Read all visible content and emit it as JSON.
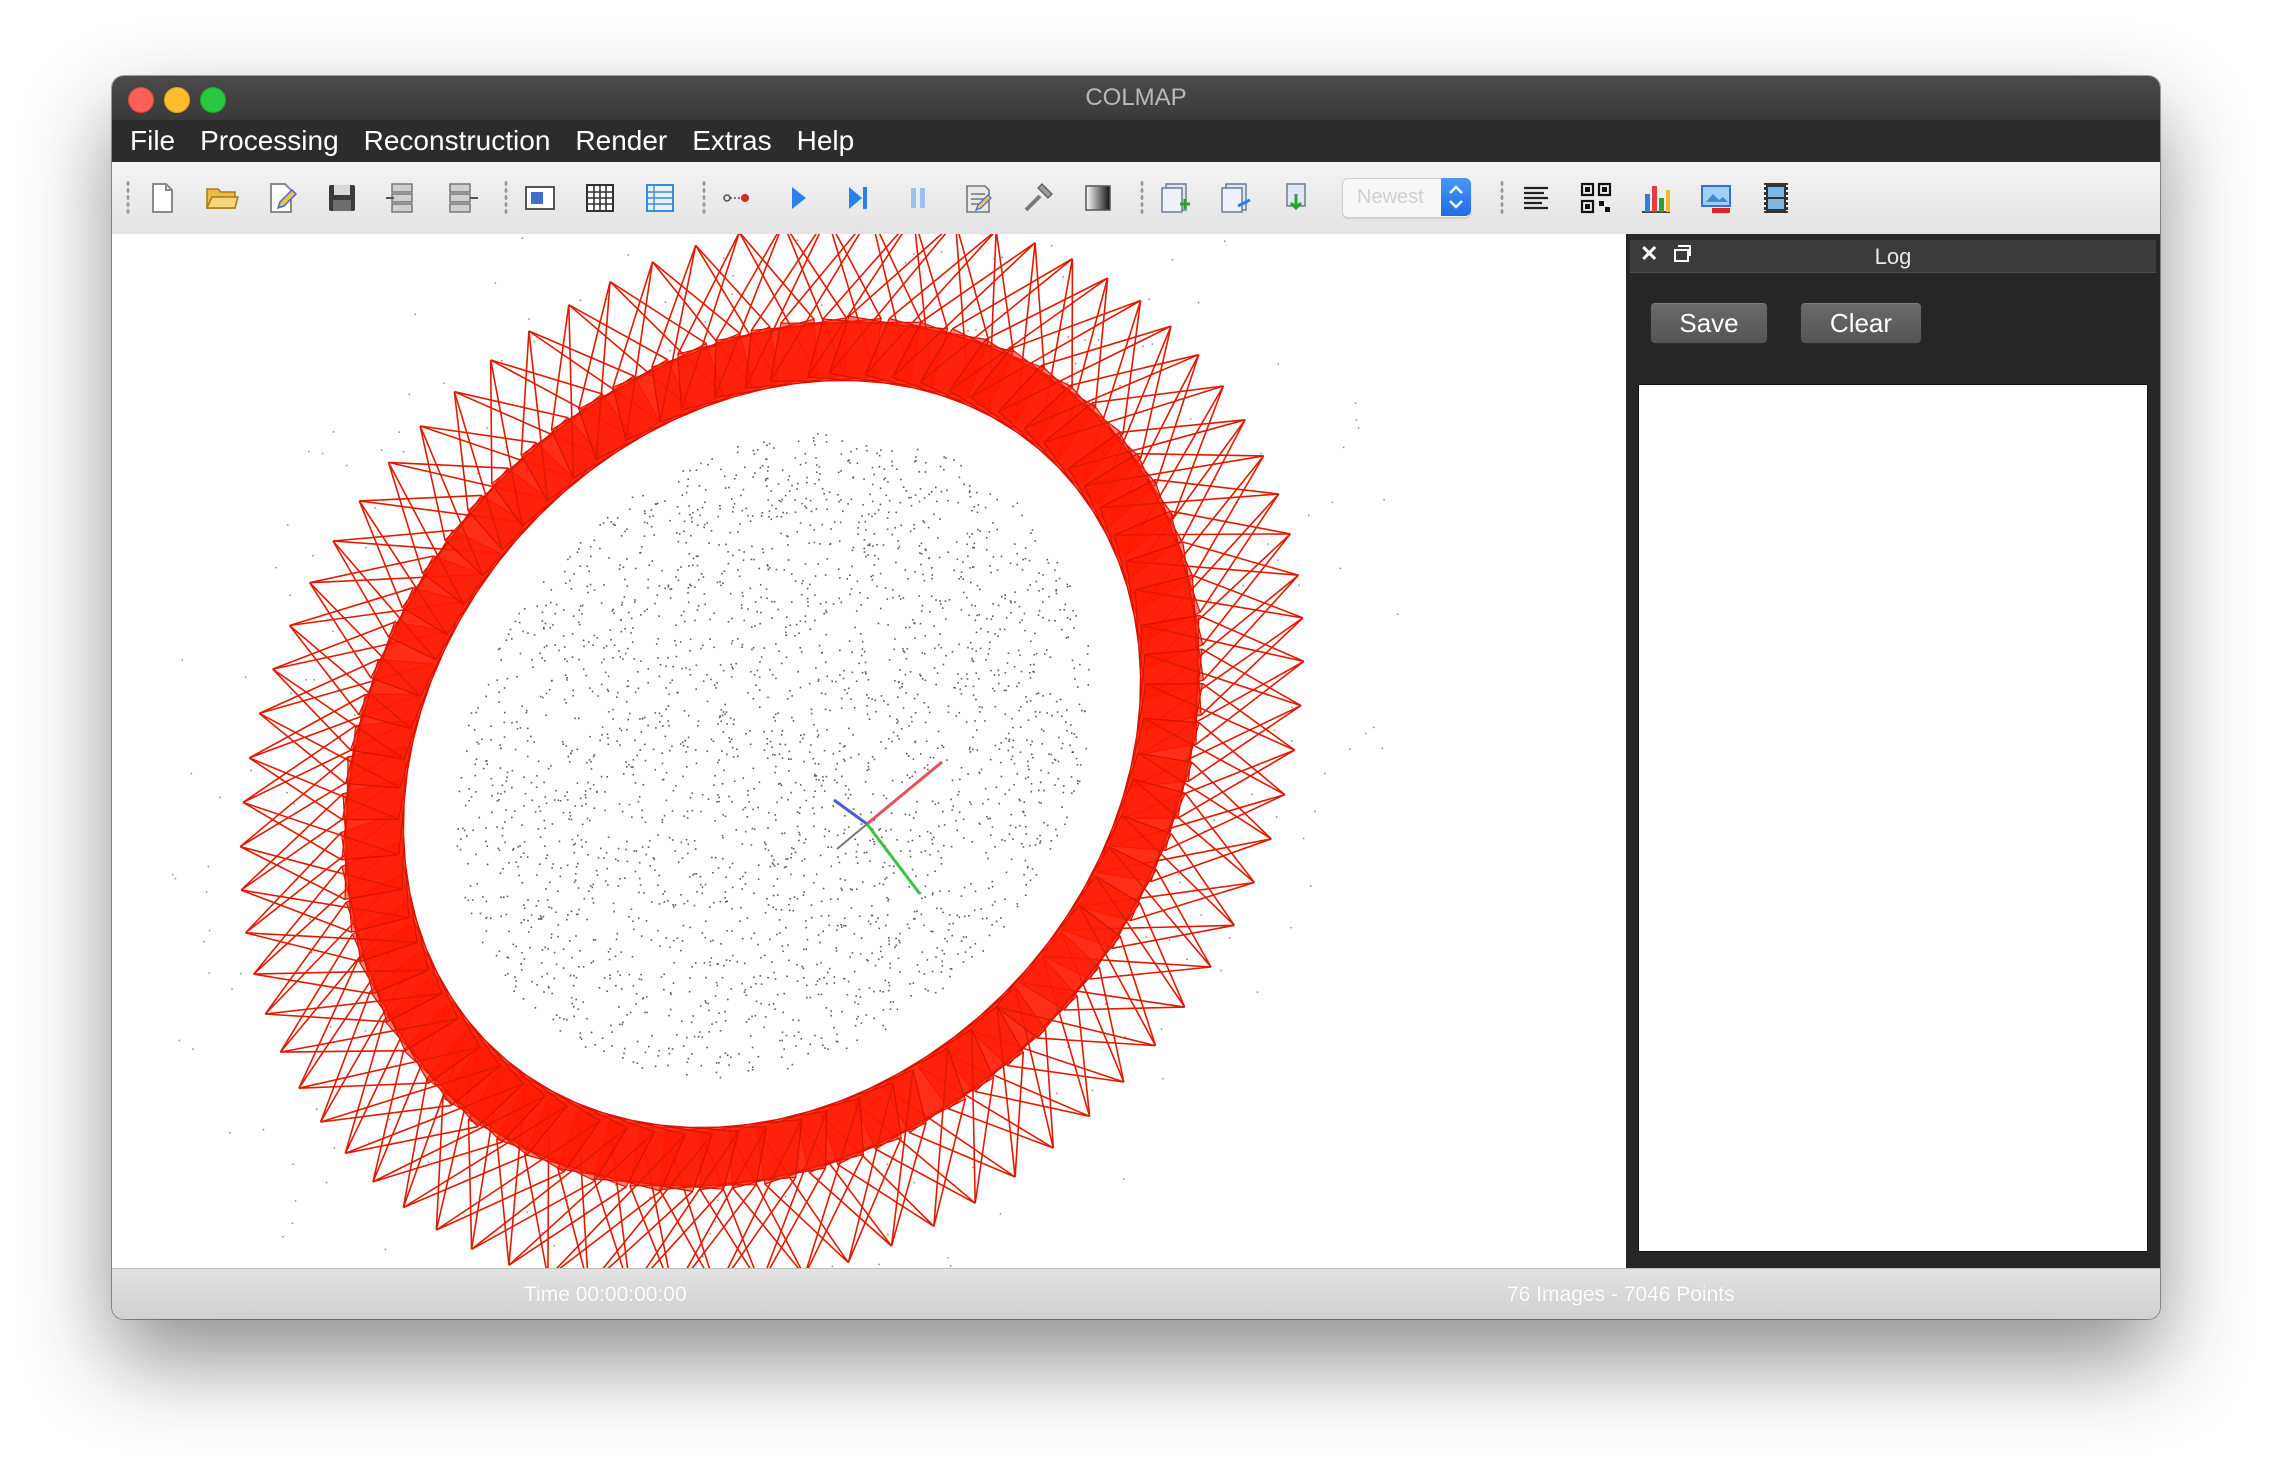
{
  "window": {
    "title": "COLMAP"
  },
  "menu": [
    "File",
    "Processing",
    "Reconstruction",
    "Render",
    "Extras",
    "Help"
  ],
  "toolbar": {
    "icons": [
      "new-project-icon",
      "open-project-icon",
      "edit-project-icon",
      "save-project-icon",
      "import-model-icon",
      "export-model-icon",
      "feature-extraction-icon",
      "feature-matching-icon",
      "database-management-icon",
      "reconstruction-options-icon",
      "start-reconstruction-icon",
      "step-reconstruction-icon",
      "pause-reconstruction-icon",
      "bundle-adjustment-icon",
      "reconstruction-settings-icon",
      "render-options-icon",
      "undistort-icon",
      "stereo-icon",
      "fusion-icon",
      "log-icon",
      "match-matrix-icon",
      "statistics-icon",
      "grab-image-icon",
      "grab-movie-icon"
    ],
    "model_select": {
      "value": "Newest"
    }
  },
  "log": {
    "title": "Log",
    "save_label": "Save",
    "clear_label": "Clear"
  },
  "status": {
    "time": "Time 00:00:00:00",
    "counts": "76 Images - 7046 Points"
  },
  "colors": {
    "camera_frustum": "#ff1a00",
    "axis_x": "#e8505a",
    "axis_y": "#3ec23e",
    "axis_z": "#4a5bdf"
  }
}
